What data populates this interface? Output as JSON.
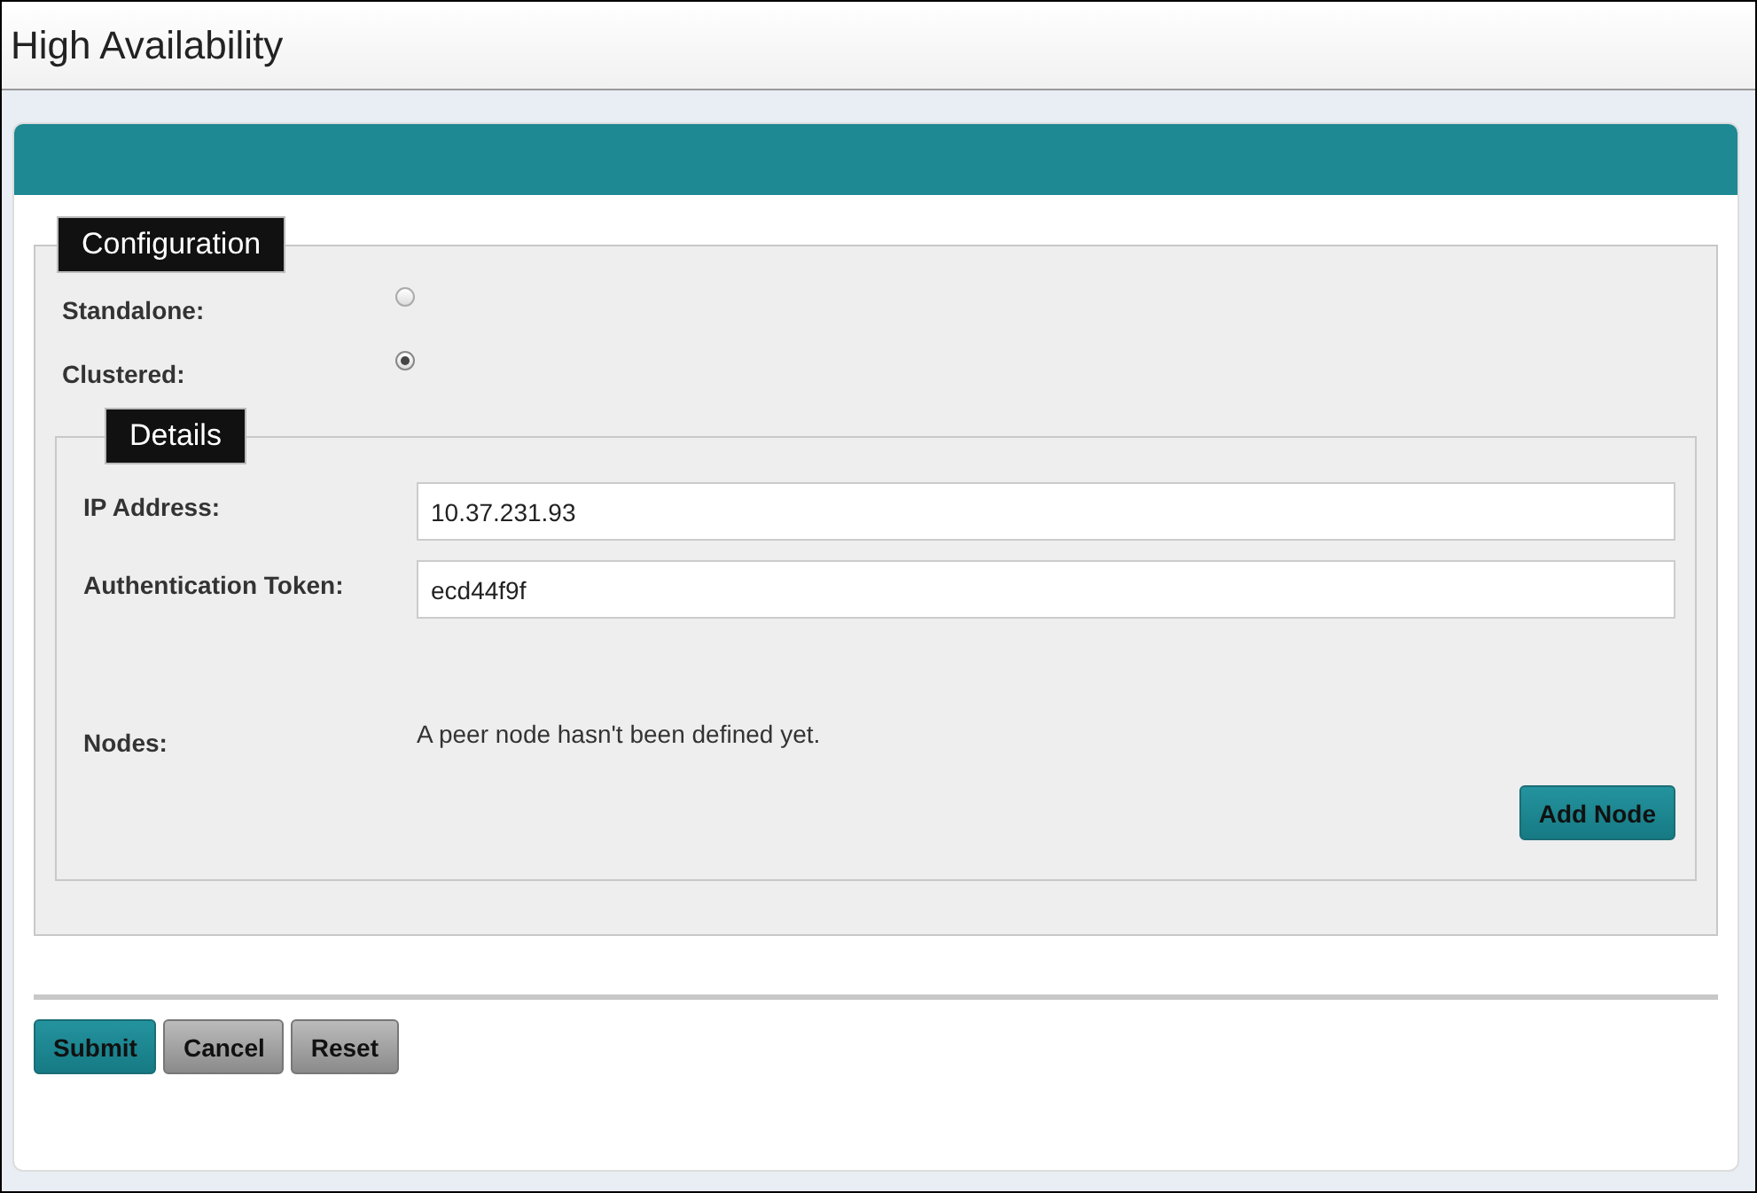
{
  "window": {
    "title": "High Availability"
  },
  "configuration": {
    "legend": "Configuration",
    "modes": [
      {
        "label": "Standalone:",
        "selected": false
      },
      {
        "label": "Clustered:",
        "selected": true
      }
    ],
    "details": {
      "legend": "Details",
      "fields": [
        {
          "label": "IP Address:",
          "value": "10.37.231.93"
        },
        {
          "label": "Authentication Token:",
          "value": "ecd44f9f"
        }
      ],
      "nodes": {
        "label": "Nodes:",
        "message": "A peer node hasn't been defined yet."
      },
      "add_button": "Add Node"
    }
  },
  "buttons": [
    {
      "label": "Submit",
      "kind": "primary"
    },
    {
      "label": "Cancel",
      "kind": "secondary"
    },
    {
      "label": "Reset",
      "kind": "secondary"
    }
  ]
}
